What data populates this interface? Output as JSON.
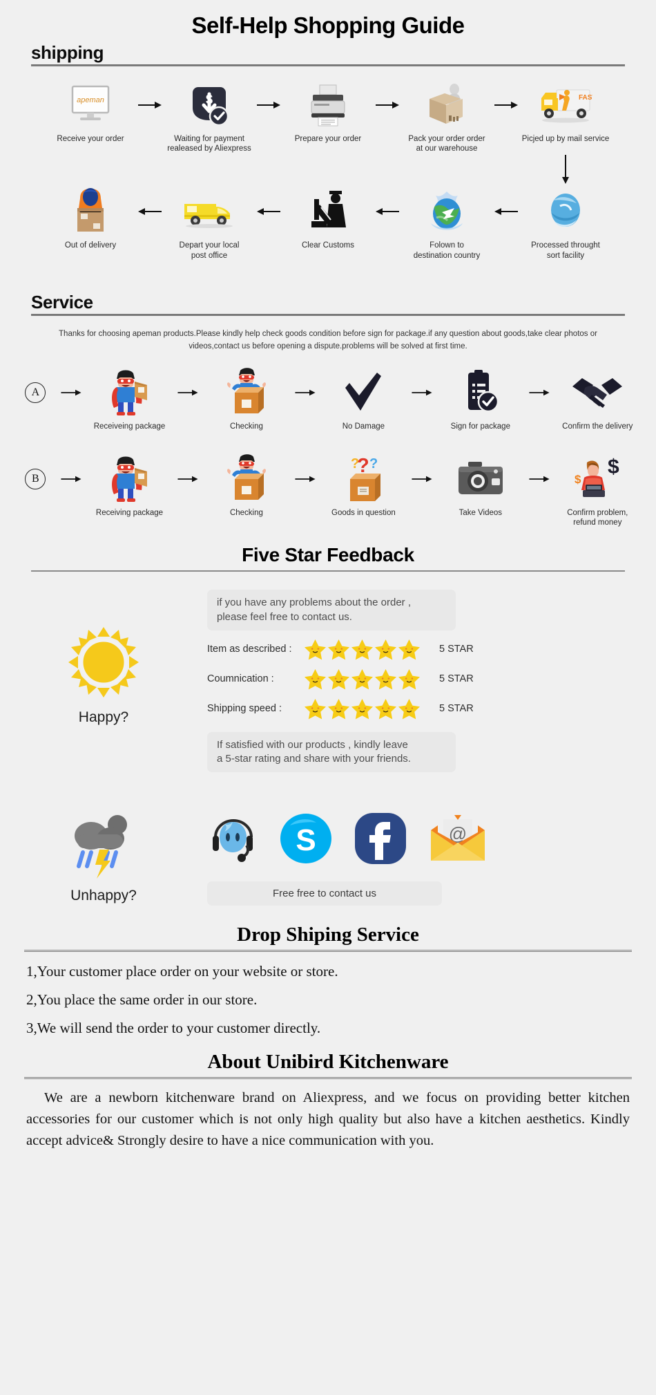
{
  "page": {
    "title": "Self-Help Shopping Guide",
    "background": "#f0f0f0"
  },
  "shipping": {
    "heading": "shipping",
    "row1": [
      {
        "icon": "monitor-apeman-icon",
        "label": "Receive your order"
      },
      {
        "icon": "payment-shield-dollar-icon",
        "label": "Waiting for payment\nrealeased by Aliexpress"
      },
      {
        "icon": "printer-icon",
        "label": "Prepare your order"
      },
      {
        "icon": "package-worker-icon",
        "label": "Pack your order order\nat our warehouse"
      },
      {
        "icon": "delivery-truck-fast-icon",
        "label": "Picjed up by mail service"
      }
    ],
    "row2": [
      {
        "icon": "courier-box-icon",
        "label": "Out of delivery"
      },
      {
        "icon": "yellow-van-icon",
        "label": "Depart your local\npost office"
      },
      {
        "icon": "customs-officer-icon",
        "label": "Clear Customs"
      },
      {
        "icon": "globe-airplane-icon",
        "label": "Folown to\ndestination country"
      },
      {
        "icon": "blue-sphere-sort-icon",
        "label": "Processed throught\nsort facility"
      }
    ]
  },
  "service": {
    "heading": "Service",
    "intro": "Thanks for choosing apeman products.Please kindly help check goods condition before sign for package.if any question about goods,take clear photos or videos,contact us before opening a dispute.problems will be solved at first time.",
    "rowA": {
      "badge": "A",
      "steps": [
        {
          "icon": "superhero-package-icon",
          "label": "Receiveing package"
        },
        {
          "icon": "happy-person-box-icon",
          "label": "Checking"
        },
        {
          "icon": "checkmark-icon",
          "label": "No Damage"
        },
        {
          "icon": "clipboard-check-icon",
          "label": "Sign for package"
        },
        {
          "icon": "handshake-icon",
          "label": "Confirm the delivery"
        }
      ]
    },
    "rowB": {
      "badge": "B",
      "steps": [
        {
          "icon": "superhero-package-icon",
          "label": "Receiving package"
        },
        {
          "icon": "happy-person-box-icon",
          "label": "Checking"
        },
        {
          "icon": "question-marks-box-icon",
          "label": "Goods in question"
        },
        {
          "icon": "camera-icon",
          "label": "Take Videos"
        },
        {
          "icon": "support-agent-dollar-icon",
          "label": "Confirm problem,\nrefund money"
        }
      ]
    }
  },
  "feedback": {
    "title": "Five Star Feedback",
    "happy_label": "Happy?",
    "happy_icon": "sun-icon",
    "bubble_top": "if you have any problems about the order ,\nplease feel free to contact us.",
    "bubble_bottom": "If satisfied with our products ,  kindly leave\na 5-star rating and share with your friends.",
    "ratings": [
      {
        "label": "Item as described :",
        "stars": 5,
        "value": "5 STAR"
      },
      {
        "label": "Coumnication :",
        "stars": 5,
        "value": "5 STAR"
      },
      {
        "label": "Shipping speed :",
        "stars": 5,
        "value": "5 STAR"
      }
    ],
    "star_color": "#f7cc15",
    "unhappy_label": "Unhappy?",
    "unhappy_icon": "rain-cloud-lightning-icon",
    "contacts": [
      {
        "icon": "aliexpress-messenger-headset-icon",
        "name": "Aliexpress Message"
      },
      {
        "icon": "skype-icon",
        "name": "Skype"
      },
      {
        "icon": "facebook-icon",
        "name": "Facebook"
      },
      {
        "icon": "email-envelope-icon",
        "name": "Email"
      }
    ],
    "contact_bar": "Free free to contact us"
  },
  "dropship": {
    "title": "Drop Shiping Service",
    "items": [
      "1,Your customer place order on your website or store.",
      "2,You place the same order in our store.",
      "3,We will send the order to your customer directly."
    ]
  },
  "about": {
    "title": "About Unibird Kitchenware",
    "paragraph": "We are a newborn kitchenware brand on Aliexpress, and we focus on providing better kitchen accessories for our customer which is not only high quality but also have a kitchen aesthetics. Kindly accept advice& Strongly desire to have a nice communication with you."
  }
}
